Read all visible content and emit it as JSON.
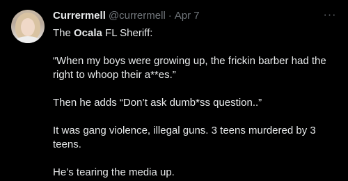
{
  "author": {
    "display_name": "Currermell",
    "handle": "@currermell",
    "separator": "·",
    "timestamp": "Apr 7"
  },
  "menu": {
    "more_label": "···"
  },
  "tweet": {
    "line1_prefix": "The ",
    "line1_bold": "Ocala",
    "line1_suffix": " FL Sheriff:",
    "quote": "“When my boys were growing up, the frickin barber had the right to whoop their a**es.”",
    "then": "Then he adds “Don’t ask dumb*ss question..”",
    "gang": "It was gang violence, illegal guns. 3 teens murdered by 3 teens.",
    "tearing": "He’s tearing the media up."
  }
}
